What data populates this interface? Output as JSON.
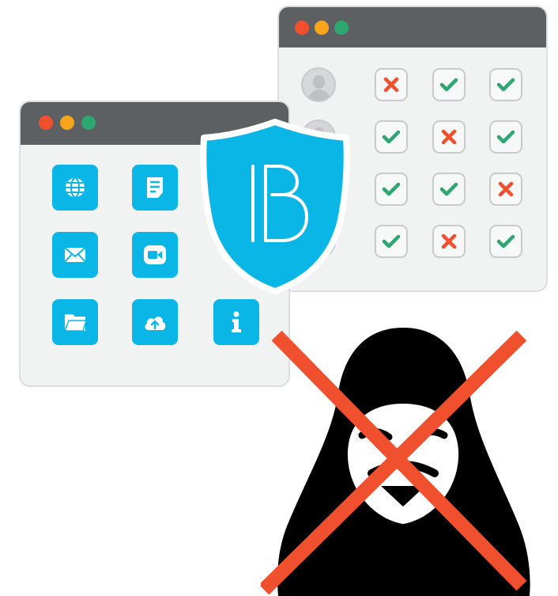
{
  "theme": {
    "accent": "#0ab6e6",
    "check": "#2ea66f",
    "cross": "#f0502e",
    "titlebar": "#5c6063",
    "dots": [
      "#f0502e",
      "#f8a51b",
      "#2ea66f"
    ]
  },
  "permissions_window": {
    "rows": [
      {
        "user": "user-avatar",
        "cells": [
          "cross",
          "check",
          "check"
        ]
      },
      {
        "user": "user-avatar",
        "cells": [
          "check",
          "cross",
          "check"
        ]
      },
      {
        "user": "user-avatar",
        "cells": [
          "check",
          "check",
          "cross"
        ]
      },
      {
        "user": "user-avatar",
        "cells": [
          "check",
          "cross",
          "check"
        ]
      }
    ]
  },
  "apps_window": {
    "icons": [
      "globe-icon",
      "document-icon",
      "hidden-icon",
      "mail-icon",
      "video-icon",
      "hidden-icon",
      "folder-icon",
      "cloud-upload-icon",
      "info-icon"
    ]
  },
  "shield": {
    "logo": "B",
    "icon": "shield-icon"
  },
  "threat": {
    "icon": "hacker-icon",
    "status": "blocked"
  }
}
